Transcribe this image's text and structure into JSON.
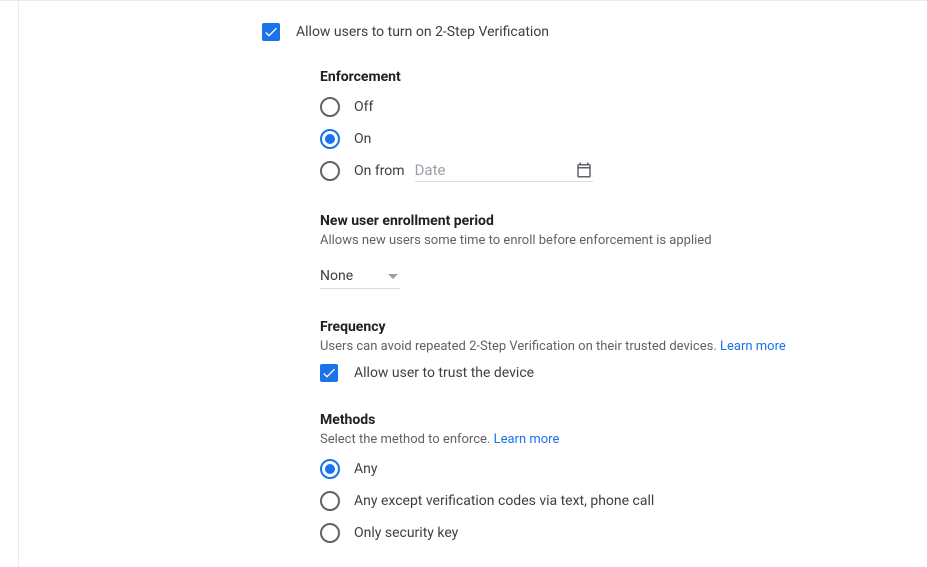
{
  "main": {
    "allow_2sv_label": "Allow users to turn on 2-Step Verification"
  },
  "enforcement": {
    "heading": "Enforcement",
    "options": {
      "off": "Off",
      "on": "On",
      "on_from": "On from"
    },
    "date_placeholder": "Date"
  },
  "enrollment": {
    "heading": "New user enrollment period",
    "desc": "Allows new users some time to enroll before enforcement is applied",
    "selected": "None"
  },
  "frequency": {
    "heading": "Frequency",
    "desc": "Users can avoid repeated 2-Step Verification on their trusted devices. ",
    "learn_more": "Learn more",
    "trust_label": "Allow user to trust the device"
  },
  "methods": {
    "heading": "Methods",
    "desc": "Select the method to enforce. ",
    "learn_more": "Learn more",
    "options": {
      "any": "Any",
      "except_codes": "Any except verification codes via text, phone call",
      "security_key": "Only security key"
    }
  }
}
